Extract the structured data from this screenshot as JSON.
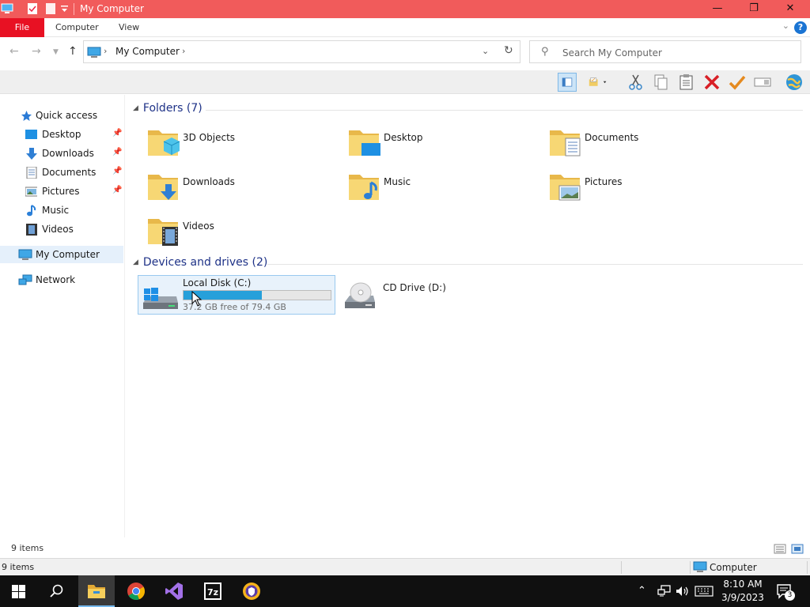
{
  "window": {
    "title": "My Computer",
    "minimize_glyph": "—",
    "maximize_glyph": "❐",
    "close_glyph": "✕"
  },
  "ribbon": {
    "file_label": "File",
    "tabs": [
      {
        "label": "Computer"
      },
      {
        "label": "View"
      }
    ],
    "help_glyph": "?"
  },
  "address": {
    "crumbs": [
      {
        "label": "My Computer"
      }
    ],
    "search_placeholder": "Search My Computer"
  },
  "sidebar": {
    "items": [
      {
        "label": "Quick access",
        "icon": "star-icon"
      },
      {
        "label": "Desktop",
        "icon": "desktop-icon",
        "pinned": true
      },
      {
        "label": "Downloads",
        "icon": "download-arrow-icon",
        "pinned": true
      },
      {
        "label": "Documents",
        "icon": "document-icon",
        "pinned": true
      },
      {
        "label": "Pictures",
        "icon": "picture-icon",
        "pinned": true
      },
      {
        "label": "Music",
        "icon": "music-note-icon"
      },
      {
        "label": "Videos",
        "icon": "film-icon"
      },
      {
        "label": "My Computer",
        "icon": "computer-icon",
        "selected": true
      },
      {
        "label": "Network",
        "icon": "network-icon"
      }
    ]
  },
  "main": {
    "folders_header": "Folders (7)",
    "folders": [
      {
        "label": "3D Objects",
        "icon": "3d-cube-folder-icon"
      },
      {
        "label": "Desktop",
        "icon": "desktop-folder-icon"
      },
      {
        "label": "Documents",
        "icon": "documents-folder-icon"
      },
      {
        "label": "Downloads",
        "icon": "downloads-folder-icon"
      },
      {
        "label": "Music",
        "icon": "music-folder-icon"
      },
      {
        "label": "Pictures",
        "icon": "pictures-folder-icon"
      },
      {
        "label": "Videos",
        "icon": "videos-folder-icon"
      }
    ],
    "drives_header": "Devices and drives (2)",
    "drives": [
      {
        "label": "Local Disk (C:)",
        "free_text": "37.2 GB free of 79.4 GB",
        "used_fraction": 0.53,
        "icon": "windows-drive-icon"
      },
      {
        "label": "CD Drive (D:)",
        "icon": "cd-drive-icon"
      }
    ]
  },
  "status": {
    "item_count": "9 items",
    "item_count_bottom": "9 items",
    "location": "Computer"
  },
  "taskbar": {
    "time": "8:10 AM",
    "date": "3/9/2023",
    "notification_count": "3"
  },
  "colors": {
    "titlebar": "#f15b5b",
    "file_tab": "#e81123",
    "drive_bar": "#26a0da",
    "header_text": "#1e3287"
  }
}
